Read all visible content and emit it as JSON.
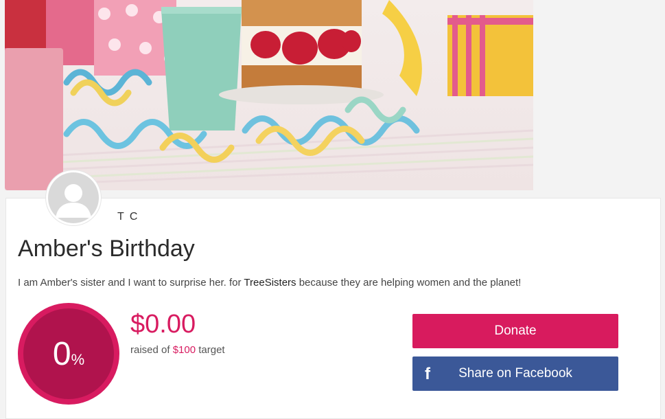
{
  "owner": {
    "name": "T C"
  },
  "campaign": {
    "title": "Amber's Birthday",
    "description_before": "I am Amber's sister and I want to surprise her. for ",
    "organization": "TreeSisters",
    "description_after": " because they are helping women and the planet!"
  },
  "progress": {
    "percent_number": "0",
    "percent_sign": "%",
    "percent_value": 0,
    "raised": "$0.00",
    "raised_prefix": "raised of ",
    "target": "$100",
    "raised_suffix": " target"
  },
  "actions": {
    "donate_label": "Donate",
    "share_label": "Share on Facebook",
    "share_icon": "f"
  },
  "colors": {
    "accent": "#d81b60",
    "ring_inner": "#b0134d",
    "facebook": "#3b5898"
  }
}
